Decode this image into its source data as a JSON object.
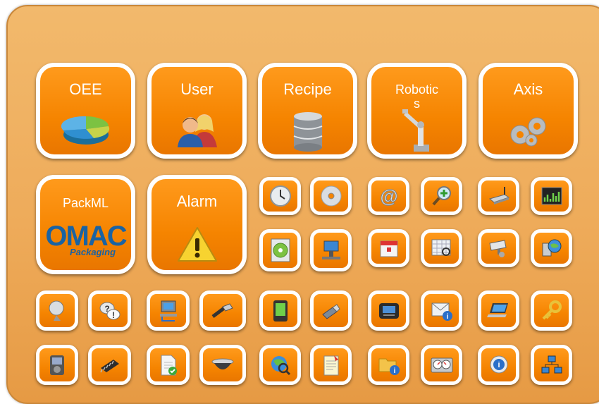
{
  "tiles": {
    "oee": {
      "label": "OEE",
      "icon": "pie-chart-icon"
    },
    "user": {
      "label": "User",
      "icon": "users-icon"
    },
    "recipe": {
      "label": "Recipe",
      "icon": "database-icon"
    },
    "robotics": {
      "label": "Robotic\ns",
      "icon": "robot-arm-icon"
    },
    "axis": {
      "label": "Axis",
      "icon": "gears-icon"
    },
    "packml": {
      "label": "PackML",
      "logo_main": "OMAC",
      "logo_sub": "Packaging"
    },
    "alarm": {
      "label": "Alarm",
      "icon": "warning-icon"
    }
  },
  "small_icons": [
    "clock-icon",
    "disc-icon",
    "email-at-icon",
    "zoom-in-icon",
    "router-icon",
    "signal-monitor-icon",
    "data-cd-icon",
    "network-computer-icon",
    "calendar-icon",
    "calendar-search-icon",
    "security-camera-icon",
    "network-globe-icon",
    "satellite-dish-icon",
    "help-chat-icon",
    "computer-network-icon",
    "usb-cable-icon",
    "pda-icon",
    "usb-drive-icon",
    "handheld-terminal-icon",
    "mail-info-icon",
    "laptop-icon",
    "key-icon",
    "media-player-icon",
    "chip-icon",
    "document-check-icon",
    "dome-camera-icon",
    "globe-search-icon",
    "notepad-icon",
    "folder-info-icon",
    "gauge-panel-icon",
    "info-bubble-icon",
    "network-topology-icon"
  ],
  "colors": {
    "tile": "#f58400",
    "panel": "#eeab5a",
    "logo_blue": "#1a63a3"
  }
}
